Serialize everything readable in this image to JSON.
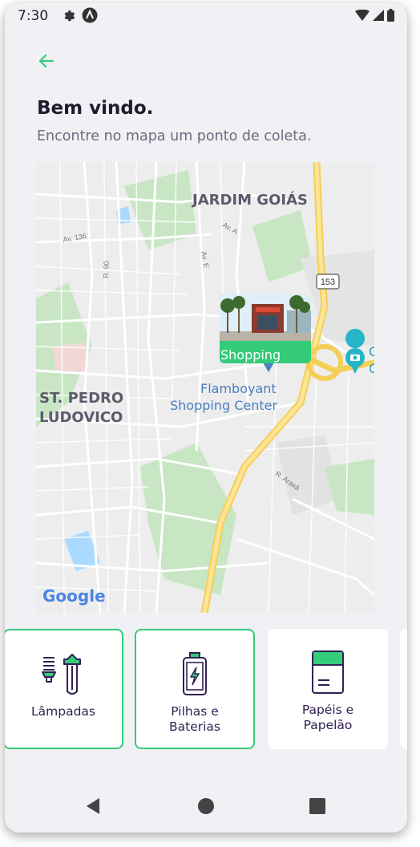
{
  "status_bar": {
    "time": "7:30"
  },
  "header": {
    "back_icon": "arrow-left-icon",
    "title": "Bem vindo.",
    "subtitle": "Encontre no mapa um ponto de coleta."
  },
  "map": {
    "labels": {
      "jardim_goias": "JARDIM GOIÁS",
      "st_pedro_1": "ST. PEDRO",
      "st_pedro_2": "LUDOVICO",
      "flamboyant_1": "Flamboyant",
      "flamboyant_2": "Shopping Center",
      "av136": "Av. 136",
      "r90": "R. 90",
      "ava": "Av. A",
      "ave": "Av. E",
      "raraxa": "R. Araxá",
      "road153": "153",
      "c1": "C",
      "c2": "C",
      "google": "Google"
    },
    "marker": {
      "label": "Shopping"
    }
  },
  "items": [
    {
      "line1": "Lâmpadas",
      "line2": "",
      "icon": "lamp-icon",
      "selected": true
    },
    {
      "line1": "Pilhas e",
      "line2": "Baterias",
      "icon": "battery-icon",
      "selected": true
    },
    {
      "line1": "Papéis e",
      "line2": "Papelão",
      "icon": "paper-icon",
      "selected": false
    }
  ],
  "colors": {
    "accent": "#34cb79",
    "title": "#1c1c2e",
    "background": "#f0f0f5"
  }
}
